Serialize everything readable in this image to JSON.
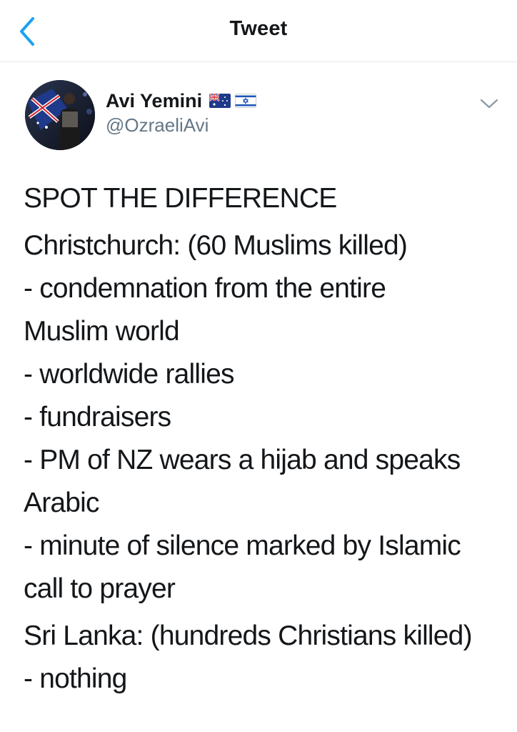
{
  "nav": {
    "title": "Tweet",
    "back_icon": "chevron-left-icon"
  },
  "author": {
    "name": "Avi Yemini",
    "handle": "@OzraeliAvi",
    "flags": [
      "australia-flag-icon",
      "israel-flag-icon"
    ]
  },
  "tweet": {
    "lines": [
      "SPOT THE DIFFERENCE",
      "Christchurch: (60 Muslims killed)",
      "- condemnation from the entire",
      "Muslim world",
      "- worldwide rallies",
      "- fundraisers",
      "- PM of NZ wears a hijab and speaks",
      "Arabic",
      "- minute of silence marked by Islamic",
      "call to prayer",
      "Sri Lanka: (hundreds Christians killed)",
      "- nothing"
    ]
  },
  "colors": {
    "accent": "#1da1f2",
    "text": "#14171a",
    "secondary": "#657786",
    "divider": "#e1e8ed"
  }
}
